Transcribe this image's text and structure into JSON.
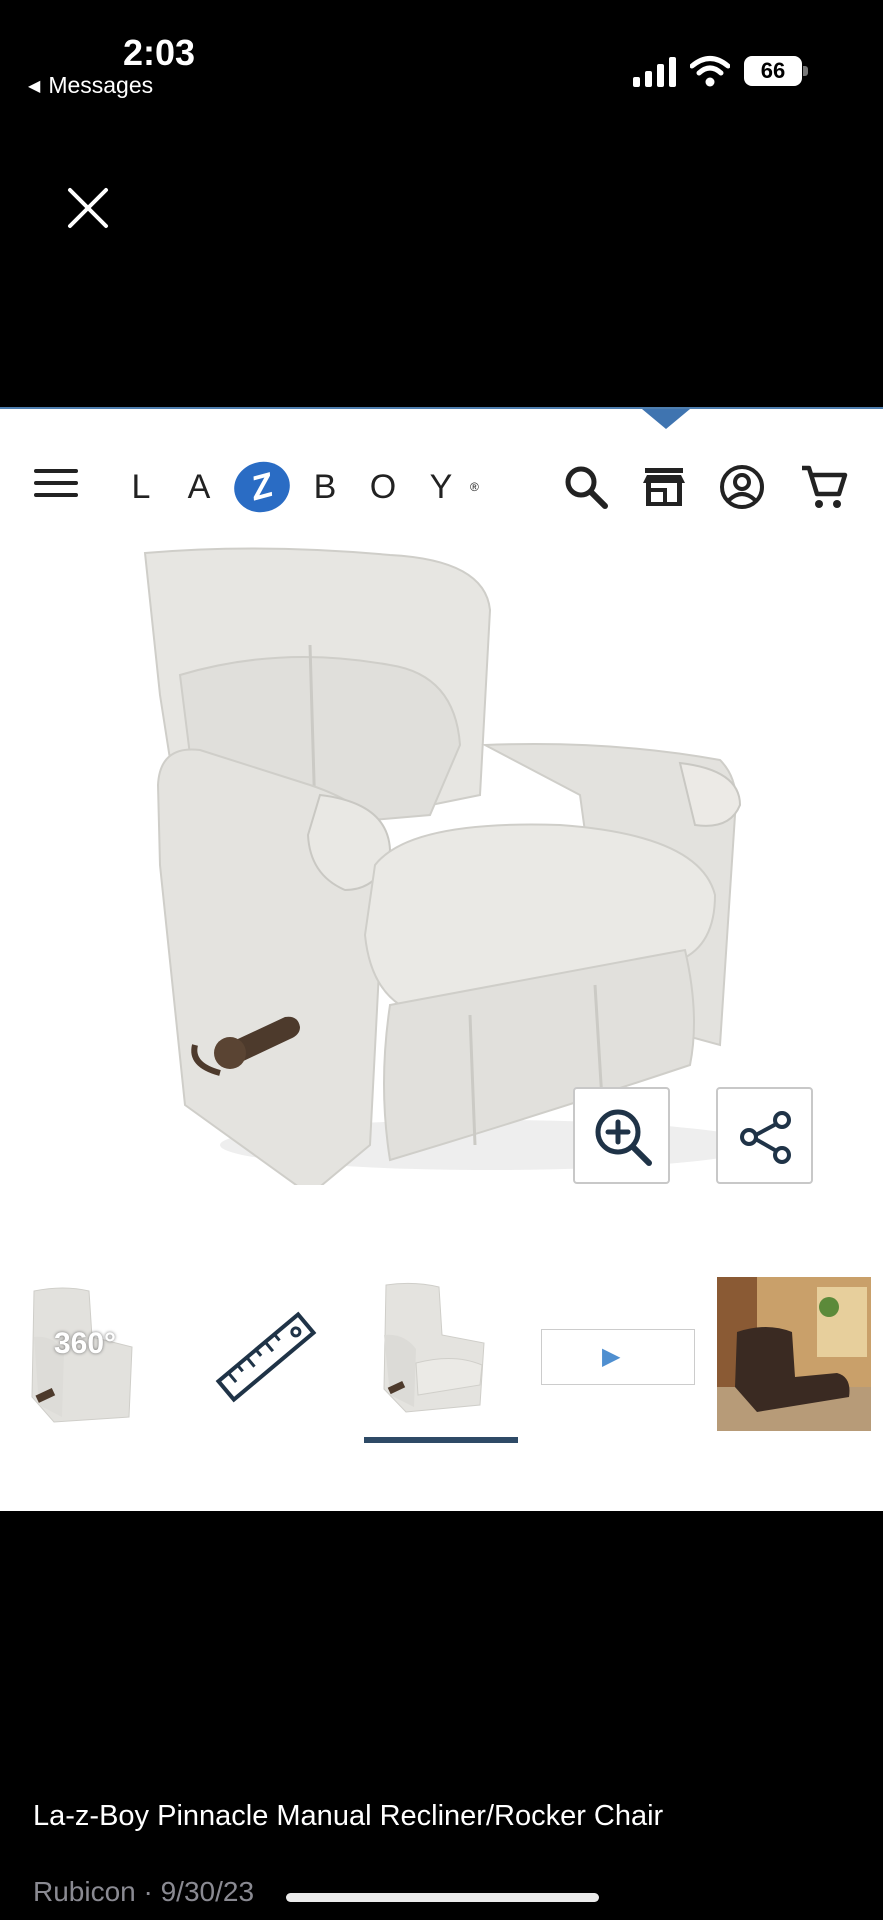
{
  "status_bar": {
    "time": "2:03",
    "back_label": "Messages",
    "battery": "66"
  },
  "viewer": {
    "close_icon": "close-icon"
  },
  "site": {
    "logo_letters": [
      "L",
      "A",
      "Z",
      "B",
      "O",
      "Y"
    ],
    "logo_mark": "®",
    "header_icons": [
      "menu-icon",
      "search-icon",
      "store-icon",
      "account-icon",
      "cart-icon"
    ]
  },
  "product_gallery": {
    "main_image": "recliner-chair-image",
    "actions": [
      "zoom-in-icon",
      "share-icon"
    ],
    "thumbnails": [
      {
        "name": "thumb-360",
        "label": "360°"
      },
      {
        "name": "thumb-dimensions"
      },
      {
        "name": "thumb-chair",
        "selected": true
      },
      {
        "name": "thumb-video"
      },
      {
        "name": "thumb-room"
      }
    ],
    "accent_color": "#2a6cc4",
    "underline_color": "#2e4a66"
  },
  "caption": {
    "title": "La-z-Boy Pinnacle Manual Recliner/Rocker Chair",
    "meta": "Rubicon · 9/30/23"
  }
}
